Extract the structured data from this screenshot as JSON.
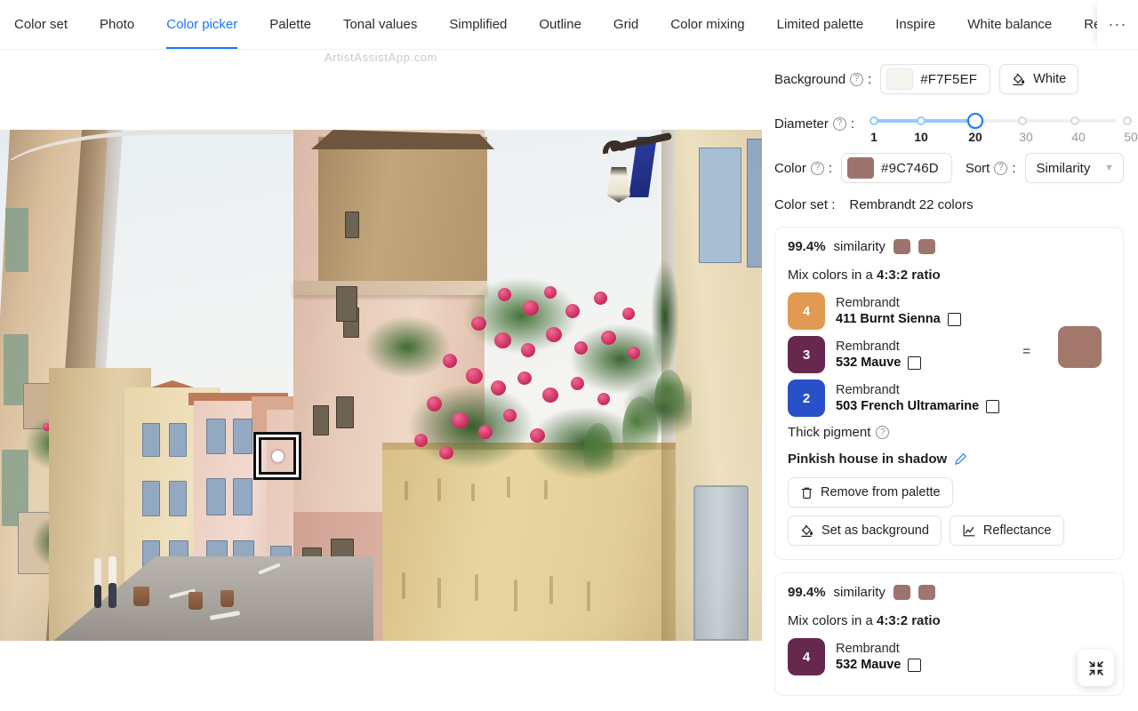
{
  "tabs": [
    {
      "label": "Color set",
      "active": false
    },
    {
      "label": "Photo",
      "active": false
    },
    {
      "label": "Color picker",
      "active": true
    },
    {
      "label": "Palette",
      "active": false
    },
    {
      "label": "Tonal values",
      "active": false
    },
    {
      "label": "Simplified",
      "active": false
    },
    {
      "label": "Outline",
      "active": false
    },
    {
      "label": "Grid",
      "active": false
    },
    {
      "label": "Color mixing",
      "active": false
    },
    {
      "label": "Limited palette",
      "active": false
    },
    {
      "label": "Inspire",
      "active": false
    },
    {
      "label": "White balance",
      "active": false
    },
    {
      "label": "Remove",
      "active": false
    }
  ],
  "tab_overflow_label": "···",
  "watermark": "ArtistAssistApp.com",
  "controls": {
    "background": {
      "label": "Background",
      "hex": "#F7F5EF",
      "swatch_color": "#F7F5EF",
      "preset_button": "White",
      "preset_icon": "paint-bucket-icon"
    },
    "diameter": {
      "label": "Diameter",
      "value": 20,
      "marks": [
        {
          "value": "1",
          "active": true
        },
        {
          "value": "10",
          "active": true
        },
        {
          "value": "20",
          "active": true
        },
        {
          "value": "30",
          "active": false
        },
        {
          "value": "40",
          "active": false
        },
        {
          "value": "50",
          "active": false
        }
      ]
    },
    "color": {
      "label": "Color",
      "hex": "#9C746D",
      "swatch_color": "#9C746D"
    },
    "sort": {
      "label": "Sort",
      "value": "Similarity"
    },
    "color_set": {
      "label": "Color set :",
      "value": "Rembrandt 22 colors"
    }
  },
  "cards": [
    {
      "similarity": "99.4%",
      "similarity_suffix": "similarity",
      "similarity_swatches": [
        "#9C746D",
        "#9E766B"
      ],
      "mix_prefix": "Mix colors in a",
      "mix_ratio": "4:3:2 ratio",
      "paints": [
        {
          "parts": "4",
          "chip_color": "#E09A52",
          "chip_text_color": "#ffffff",
          "brand": "Rembrandt",
          "name": "411 Burnt Sienna"
        },
        {
          "parts": "3",
          "chip_color": "#66284F",
          "chip_text_color": "#ffffff",
          "brand": "Rembrandt",
          "name": "532 Mauve"
        },
        {
          "parts": "2",
          "chip_color": "#2850C8",
          "chip_text_color": "#ffffff",
          "brand": "Rembrandt",
          "name": "503 French Ultramarine"
        }
      ],
      "equals_sign": "=",
      "result_color": "#A2786A",
      "thick_pigment": "Thick pigment",
      "title": "Pinkish house in shadow",
      "actions": [
        {
          "label": "Remove from palette",
          "icon": "trash-icon"
        },
        {
          "label": "Set as background",
          "icon": "paint-bucket-icon"
        },
        {
          "label": "Reflectance",
          "icon": "line-chart-icon"
        }
      ]
    },
    {
      "similarity": "99.4%",
      "similarity_suffix": "similarity",
      "similarity_swatches": [
        "#9C746D",
        "#9E766B"
      ],
      "mix_prefix": "Mix colors in a",
      "mix_ratio": "4:3:2 ratio",
      "paints": [
        {
          "parts": "4",
          "chip_color": "#66284F",
          "chip_text_color": "#ffffff",
          "brand": "Rembrandt",
          "name": "532 Mauve"
        }
      ]
    }
  ],
  "fullscreen_button": {
    "icon": "compress-icon"
  },
  "accent_color": "#1677FF"
}
